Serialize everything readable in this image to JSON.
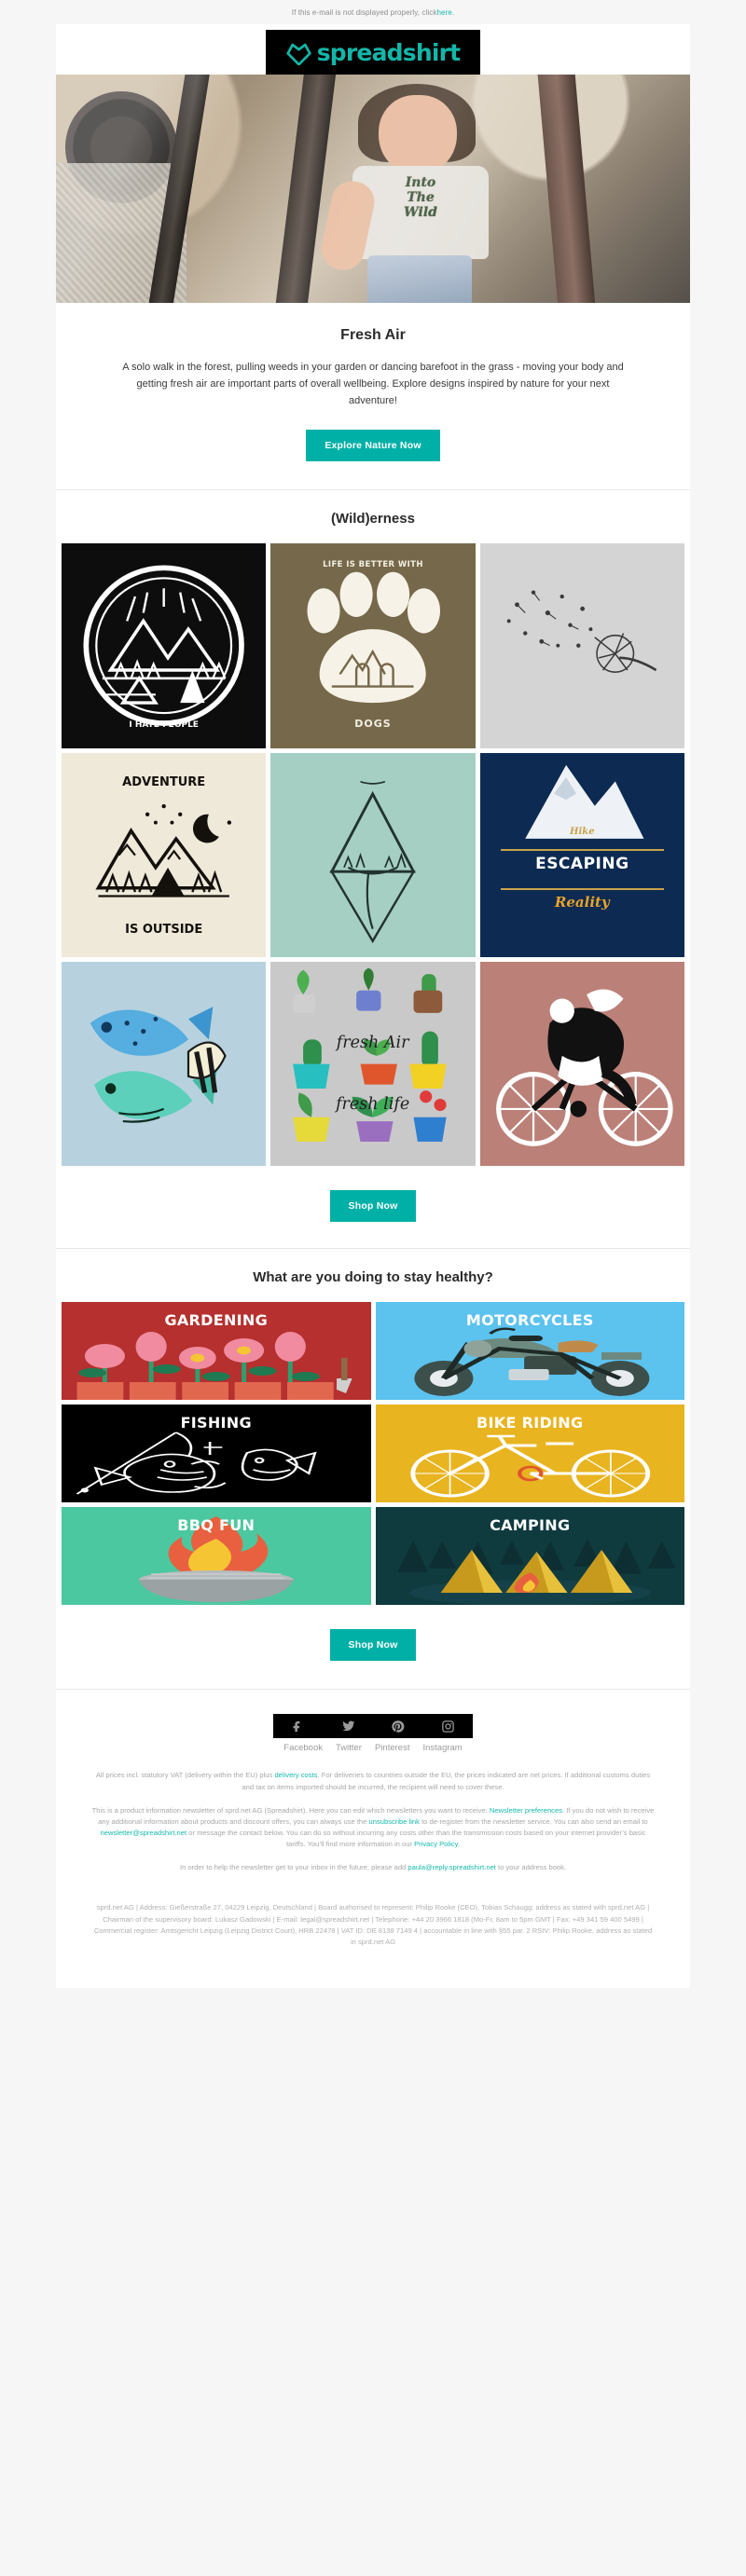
{
  "preheader": {
    "text_before": "If this e-mail is not displayed properly, click ",
    "link": "here",
    "text_after": "."
  },
  "brand": {
    "name": "spreadshirt",
    "logo_icon": "spreadshirt-heart-logo",
    "accent_color": "#00b0a6",
    "logo_bg": "#000000"
  },
  "hero": {
    "alt_name": "woman-leaning-out-of-car-window",
    "shirt_text_line1": "Into",
    "shirt_text_line2": "The",
    "shirt_text_line3": "Wild"
  },
  "intro": {
    "title": "Fresh Air",
    "body": "A solo walk in the forest, pulling weeds in your garden or dancing barefoot in the grass - moving your body and getting fresh air are important parts of overall wellbeing. Explore designs inspired by nature for your next adventure!",
    "cta_label": "Explore Nature Now"
  },
  "wilderness": {
    "title": "(Wild)erness",
    "cta_label": "Shop Now",
    "tiles": [
      {
        "name": "i-hate-people-camp-badge",
        "caption": "I HATE PEOPLE",
        "bg": "#0d0d0d",
        "ink": "#ffffff"
      },
      {
        "name": "life-is-better-with-dogs-paw",
        "caption_top": "LIFE IS BETTER WITH",
        "caption": "DOGS",
        "bg": "#76684a",
        "ink": "#f3efe3"
      },
      {
        "name": "dandelion-seeds-blowing",
        "caption": "",
        "bg": "#d4d4d4",
        "ink": "#2b2b2b"
      },
      {
        "name": "adventure-is-outside-mountains",
        "caption_top": "ADVENTURE",
        "caption": "IS OUTSIDE",
        "bg": "#efe9d9",
        "ink": "#14110d"
      },
      {
        "name": "floating-island-waterfall-sketch",
        "caption": "",
        "bg": "#a5cfc3",
        "ink": "#23332e"
      },
      {
        "name": "hike-escaping-reality-badge",
        "caption_top": "Hike",
        "caption": "ESCAPING",
        "caption_bottom": "Reality",
        "bg": "#0d2a52",
        "ink": "#ffffff",
        "accent": "#c9a24a"
      },
      {
        "name": "watercolor-tropical-fish",
        "caption": "",
        "bg": "#b7d2de",
        "ink": "#1b4f6b"
      },
      {
        "name": "fresh-air-fresh-life-potted-plants",
        "caption_top": "fresh Air",
        "caption": "fresh life",
        "bg": "#c9c9c9",
        "ink": "#1f1f1f"
      },
      {
        "name": "bear-riding-bicycle",
        "caption": "",
        "bg": "#bb8078",
        "ink": "#101010"
      }
    ]
  },
  "healthy": {
    "title": "What are you doing to stay healthy?",
    "cta_label": "Shop Now",
    "cards": [
      {
        "name": "card-gardening",
        "label": "GARDENING",
        "bg": "#b5302e"
      },
      {
        "name": "card-motorcycles",
        "label": "MOTORCYCLES",
        "bg": "#5cc2ee"
      },
      {
        "name": "card-fishing",
        "label": "FISHING",
        "bg": "#000000"
      },
      {
        "name": "card-bike-riding",
        "label": "BIKE RIDING",
        "bg": "#e8b420"
      },
      {
        "name": "card-bbq-fun",
        "label": "BBQ FUN",
        "bg": "#4cc8a0"
      },
      {
        "name": "card-camping",
        "label": "CAMPING",
        "bg": "#0f3b3f"
      }
    ]
  },
  "footer": {
    "social": [
      {
        "name": "facebook",
        "label": "Facebook",
        "icon": "facebook-icon"
      },
      {
        "name": "twitter",
        "label": "Twitter",
        "icon": "twitter-icon"
      },
      {
        "name": "pinterest",
        "label": "Pinterest",
        "icon": "pinterest-icon"
      },
      {
        "name": "instagram",
        "label": "Instagram",
        "icon": "instagram-icon"
      }
    ],
    "vat_1": "All prices incl. statutory VAT (delivery within the EU) plus ",
    "vat_link": "delivery costs",
    "vat_2": ". For deliveries to countries outside the EU, the prices indicated are net prices. If additional customs duties and tax on items imported should be incurred, the recipient will need to cover these.",
    "news_1": "This is a product information newsletter of sprd.net AG (Spreadshirt). Here you can edit which newsletters you want to receive: ",
    "news_link_1": "Newsletter preferences",
    "news_2": ". If you do not wish to receive any additional information about products and discount offers, you can always use the ",
    "news_link_2": "unsubscribe link",
    "news_3": " to de-register from the newsletter service. You can also send an email to ",
    "news_link_3": "newsletter@spreadshirt.net",
    "news_4": " or message the contact below. You can do so without incurring any costs other than the transmission costs based on your internet provider’s basic tariffs. You’ll find more information in our ",
    "news_link_4": "Privacy Policy",
    "news_5": ".",
    "inbox_1": "In order to help the newsletter get to your inbox in the future, please add ",
    "inbox_link": "paula@reply.spreadshirt.net",
    "inbox_2": " to your address book.",
    "imprint": "sprd.net AG | Address: Gießerstraße 27, 04229 Leipzig, Deutschland | Board authorised to represent: Philip Rooke (CEO), Tobias Schaugg; address as stated with sprd.net AG | Chairman of the supervisory board: Lukasz Gadowski | E-mail: legal@spreadshirt.net | Telephone: +44 20 3966 1818 (Mo-Fr, 8am to 5pm GMT | Fax: +49 341 59 400 5499 | Commercial register: Amtsgericht Leipzig (Leipzig District Court), HRB 22478 | VAT ID: DE 8138 7149 4 | accountable in line with §55 par. 2 RStV: Philip Rooke, address as stated in sprd.net AG"
  }
}
